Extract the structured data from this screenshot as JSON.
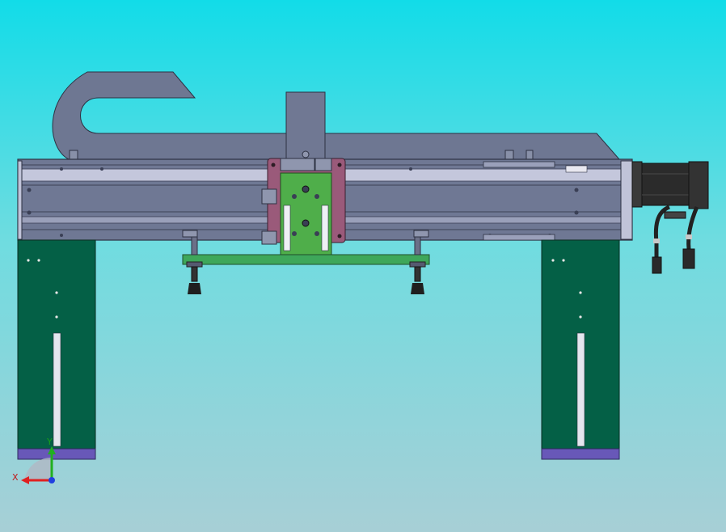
{
  "view": {
    "axis_x_label": "X",
    "axis_y_label": "Y"
  },
  "colors": {
    "background_top": "#12dce8",
    "background_bottom": "#a7cfd6",
    "cable_carrier": "#6e7792",
    "actuator_body": "#6f7894",
    "actuator_rail": "#c4c7dc",
    "carriage_plate": "#9a5a7a",
    "slider_green": "#4fae4a",
    "crossbar_green": "#3ea75a",
    "support_leg": "#046046",
    "foot_plate": "#6858b8",
    "motor": "#2b2b2b",
    "axis_x": "#e02020",
    "axis_y": "#20b020",
    "axis_z": "#2040e0"
  }
}
